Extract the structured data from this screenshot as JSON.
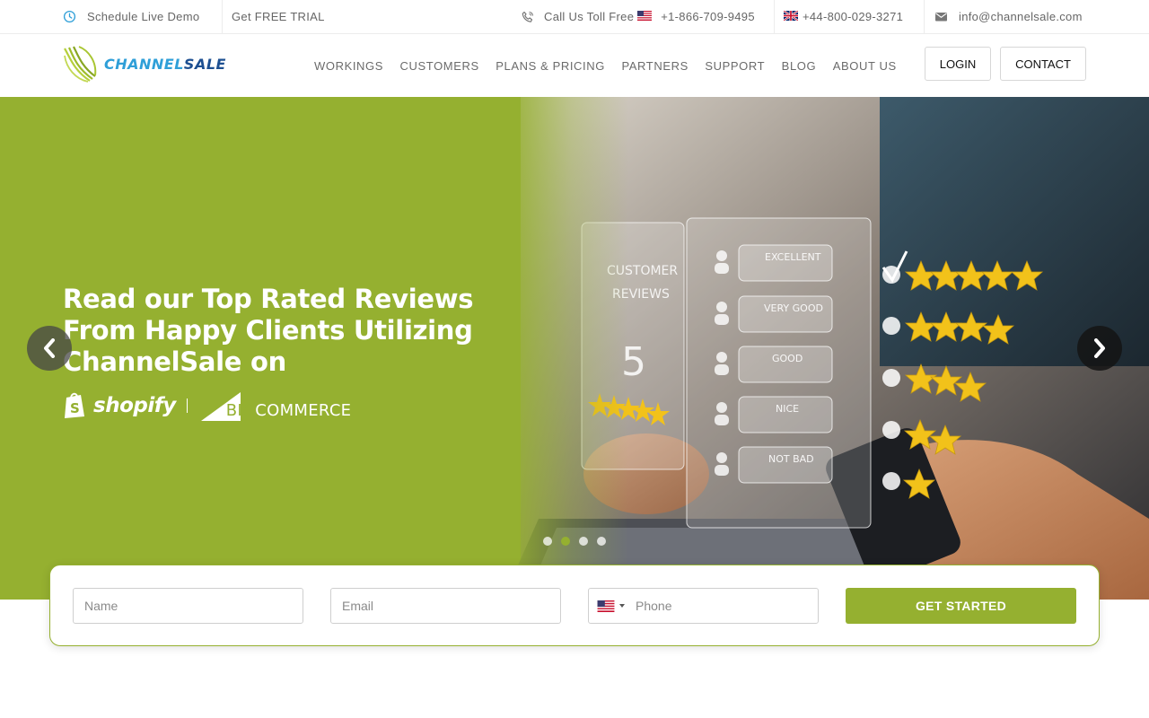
{
  "topbar": {
    "schedule_demo": "Schedule Live Demo",
    "free_trial": "Get FREE TRIAL",
    "call_label": "Call Us Toll Free",
    "phone_us": "+1-866-709-9495",
    "phone_uk": "+44-800-029-3271",
    "email": "info@channelsale.com",
    "icons": [
      "clock-icon",
      "phone-icon",
      "us-flag-icon",
      "uk-flag-icon",
      "envelope-icon"
    ]
  },
  "header": {
    "logo_text_part1": "CHANNEL",
    "logo_text_part2": "SALE",
    "nav": [
      "WORKINGS",
      "CUSTOMERS",
      "PLANS & PRICING",
      "PARTNERS",
      "SUPPORT",
      "BLOG",
      "ABOUT US"
    ],
    "login_label": "LOGIN",
    "contact_label": "CONTACT"
  },
  "hero": {
    "title": "Read our Top Rated Reviews From Happy Clients Utilizing ChannelSale on",
    "brand1": "shopify",
    "brand2_big": "BIG",
    "brand2_rest": "COMMERCE",
    "slide_count": 4,
    "active_slide": 2,
    "image_text": {
      "customer": "CUSTOMER",
      "reviews": "REVIEWS",
      "score": "5",
      "ratings": [
        "EXCELLENT",
        "VERY GOOD",
        "GOOD",
        "NICE",
        "NOT BAD"
      ]
    }
  },
  "form": {
    "name_placeholder": "Name",
    "email_placeholder": "Email",
    "phone_placeholder": "Phone",
    "submit_label": "GET STARTED"
  },
  "colors": {
    "brand_green": "#95b030",
    "logo_blue_light": "#2f9fd8",
    "logo_blue_dark": "#1d4f91"
  }
}
